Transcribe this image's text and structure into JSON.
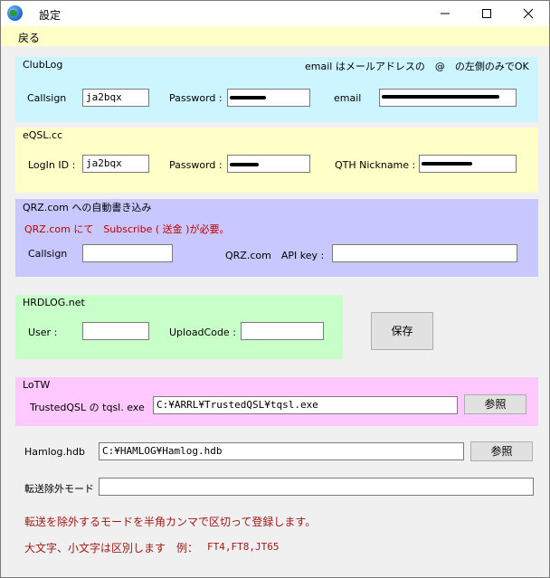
{
  "window": {
    "title": "設定",
    "minimize_icon": "minimize-icon",
    "maximize_icon": "maximize-icon",
    "close_icon": "close-icon"
  },
  "menu": {
    "back": "戻る"
  },
  "colors": {
    "clublog_bg": "#ccf5ff",
    "eqsl_bg": "#ffffc8",
    "qrz_bg": "#c8c8ff",
    "hrdlog_bg": "#c8ffc8",
    "lotw_bg": "#ffc8ff",
    "menubar_bg": "#ffffc8"
  },
  "clublog": {
    "title": "ClubLog",
    "note": "email はメールアドレスの　@　の左側のみでOK",
    "callsign_label": "Callsign",
    "callsign_value": "ja2bqx",
    "password_label": "Password :",
    "email_label": "email"
  },
  "eqsl": {
    "title": "eQSL.cc",
    "login_label": "LogIn ID :",
    "login_value": "ja2bqx",
    "password_label": "Password :",
    "qth_label": "QTH Nickname :"
  },
  "qrz": {
    "title": "QRZ.com への自動書き込み",
    "notice": "QRZ.com にて　Subscribe ( 送金 )が必要。",
    "callsign_label": "Callsign",
    "callsign_value": "",
    "apikey_label": "QRZ.com　API key :",
    "apikey_value": ""
  },
  "hrdlog": {
    "title": "HRDLOG.net",
    "user_label": "User :",
    "user_value": "",
    "upload_label": "UploadCode :",
    "upload_value": ""
  },
  "save_button": "保存",
  "lotw": {
    "title": "LoTW",
    "tqsl_label": "TrustedQSL の tqsl. exe",
    "tqsl_path": "C:¥ARRL¥TrustedQSL¥tqsl.exe",
    "browse": "参照"
  },
  "hamlog": {
    "label": "Hamlog.hdb",
    "path": "C:¥HAMLOG¥Hamlog.hdb",
    "browse": "参照"
  },
  "exclude": {
    "label": "転送除外モード",
    "value": "",
    "help1": "転送を除外するモードを半角カンマで区切って登録します。",
    "help2": "大文字、小文字は区別します　例：",
    "example": "FT4,FT8,JT65"
  }
}
